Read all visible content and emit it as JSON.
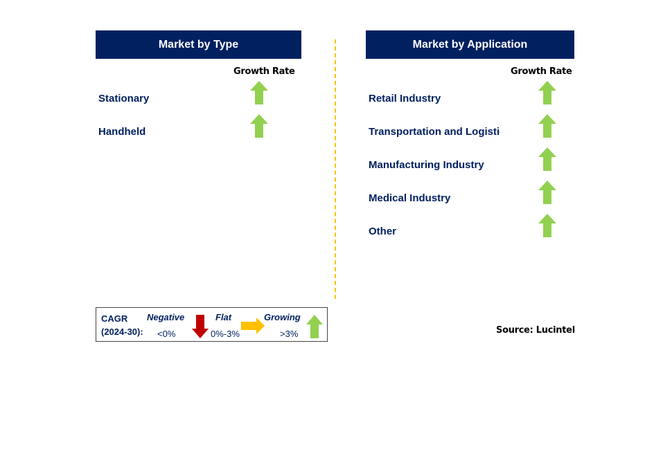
{
  "colors": {
    "header_bg": "#002060",
    "up": "#92D050",
    "down": "#C00000",
    "flat": "#FFC000",
    "divider": "#FFC000"
  },
  "left": {
    "title": "Market by Type",
    "growth_label": "Growth Rate",
    "items": [
      {
        "label": "Stationary",
        "trend": "up-arrow-icon"
      },
      {
        "label": "Handheld",
        "trend": "up-arrow-icon"
      }
    ]
  },
  "right": {
    "title": "Market by Application",
    "growth_label": "Growth Rate",
    "items": [
      {
        "label": "Retail Industry",
        "trend": "up-arrow-icon"
      },
      {
        "label": "Transportation and Logistics",
        "trend": "up-arrow-icon"
      },
      {
        "label": "Manufacturing Industry",
        "trend": "up-arrow-icon"
      },
      {
        "label": "Medical Industry",
        "trend": "up-arrow-icon"
      },
      {
        "label": "Other",
        "trend": "up-arrow-icon"
      }
    ]
  },
  "legend": {
    "cagr": "CAGR",
    "period": "(2024-30):",
    "negative": "Negative",
    "negative_range": "<0%",
    "flat": "Flat",
    "flat_range": "0%-3%",
    "growing": "Growing",
    "growing_range": ">3%"
  },
  "source": "Source: Lucintel"
}
